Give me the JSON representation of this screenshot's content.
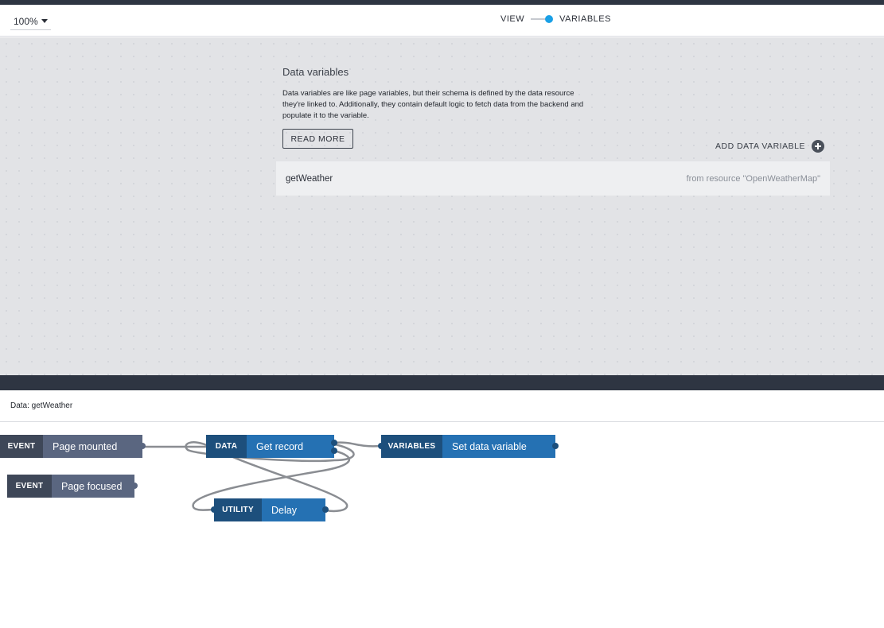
{
  "toolbar": {
    "zoom_value": "100%",
    "mode_left": "VIEW",
    "mode_right": "VARIABLES"
  },
  "data_variables": {
    "title": "Data variables",
    "description": "Data variables are like page variables, but their schema is defined by the data resource they're linked to. Additionally, they contain default logic to fetch data from the backend and populate it to the variable.",
    "read_more_label": "READ MORE",
    "add_label": "ADD DATA VARIABLE",
    "items": [
      {
        "name": "getWeather",
        "source": "from resource \"OpenWeatherMap\""
      }
    ]
  },
  "flow": {
    "title": "Data: getWeather",
    "nodes": {
      "page_mounted": {
        "tag": "EVENT",
        "label": "Page mounted"
      },
      "page_focused": {
        "tag": "EVENT",
        "label": "Page focused"
      },
      "get_record": {
        "tag": "DATA",
        "label": "Get record"
      },
      "set_data_variable": {
        "tag": "VARIABLES",
        "label": "Set data variable"
      },
      "delay": {
        "tag": "UTILITY",
        "label": "Delay"
      }
    }
  },
  "colors": {
    "dark_bar": "#2e3542",
    "accent": "#1aa0e6",
    "event_tag": "#3e4758",
    "event_label": "#5a6680",
    "block_tag": "#1d4f7c",
    "block_label": "#2571b3",
    "wire": "#8a8d92"
  }
}
